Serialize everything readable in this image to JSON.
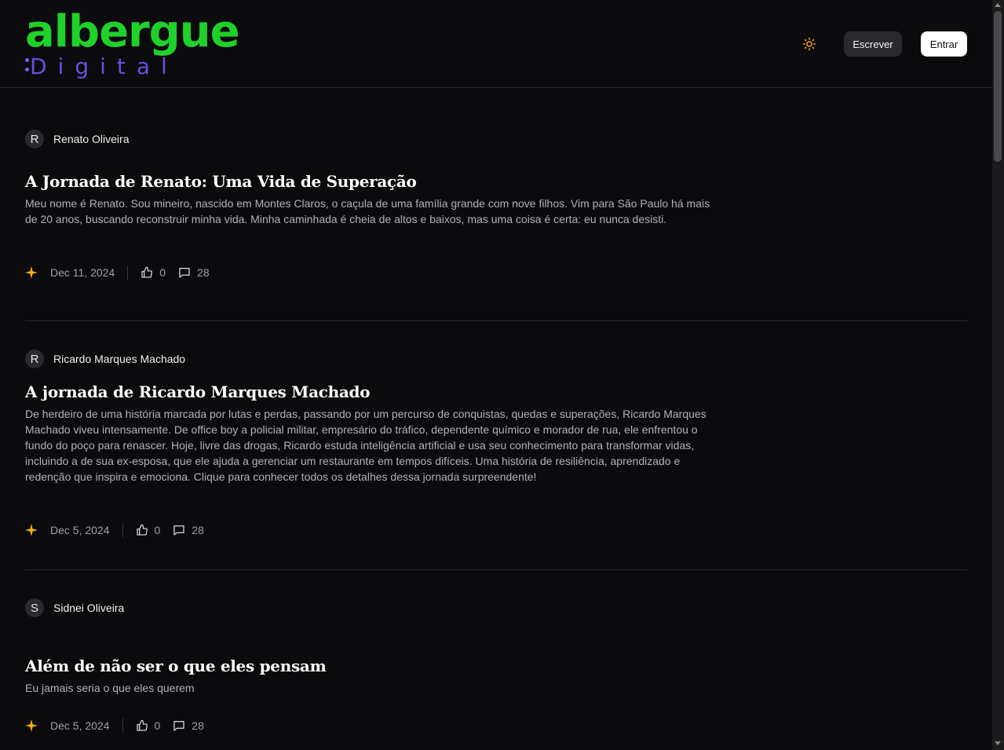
{
  "header": {
    "logo_top": "albergue",
    "logo_bottom": "Digital",
    "write_label": "Escrever",
    "login_label": "Entrar"
  },
  "colors": {
    "brand_green": "#1fd12a",
    "brand_purple": "#6a4fe0",
    "sparkle": "#f5b301",
    "background": "#0b0a0d"
  },
  "posts": [
    {
      "avatar_initial": "R",
      "author": "Renato Oliveira",
      "title": "A Jornada de Renato: Uma Vida de Superação",
      "excerpt": "Meu nome é Renato. Sou mineiro, nascido em Montes Claros, o caçula de uma família grande com nove filhos. Vim para São Paulo há mais de 20 anos, buscando reconstruir minha vida. Minha caminhada é cheia de altos e baixos, mas uma coisa é certa: eu nunca desisti.",
      "date": "Dec 11, 2024",
      "likes": "0",
      "comments": "28"
    },
    {
      "avatar_initial": "R",
      "author": "Ricardo Marques Machado",
      "title": "A jornada de Ricardo Marques Machado",
      "excerpt": "De herdeiro de uma história marcada por lutas e perdas, passando por um percurso de conquistas, quedas e superações, Ricardo Marques Machado viveu intensamente. De office boy a policial militar, empresário do tráfico, dependente químico e morador de rua, ele enfrentou o fundo do poço para renascer. Hoje, livre das drogas, Ricardo estuda inteligência artificial e usa seu conhecimento para transformar vidas, incluindo a de sua ex-esposa, que ele ajuda a gerenciar um restaurante em tempos difíceis. Uma história de resiliência, aprendizado e redenção que inspira e emociona. Clique para conhecer todos os detalhes dessa jornada surpreendente!",
      "date": "Dec 5, 2024",
      "likes": "0",
      "comments": "28"
    },
    {
      "avatar_initial": "S",
      "author": "Sidnei Oliveira",
      "title": "Além de não ser o que eles pensam",
      "excerpt": "Eu jamais seria o que eles querem",
      "date": "Dec 5, 2024",
      "likes": "0",
      "comments": "28"
    }
  ]
}
